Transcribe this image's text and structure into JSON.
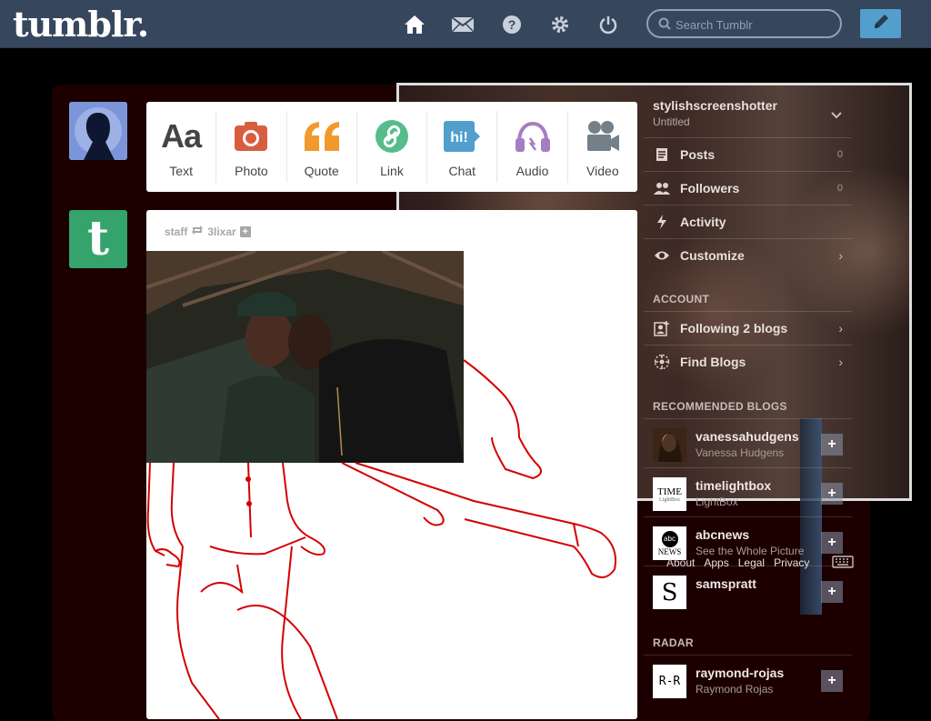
{
  "header": {
    "logo": "tumblr.",
    "search_placeholder": "Search Tumblr",
    "nav": [
      "home-icon",
      "mail-icon",
      "help-icon",
      "gear-icon",
      "power-icon"
    ]
  },
  "post_types": [
    {
      "label": "Text",
      "icon": "text-icon",
      "color": "#444444"
    },
    {
      "label": "Photo",
      "icon": "camera-icon",
      "color": "#d95e40"
    },
    {
      "label": "Quote",
      "icon": "quote-icon",
      "color": "#f2992e"
    },
    {
      "label": "Link",
      "icon": "link-icon",
      "color": "#56bc8a"
    },
    {
      "label": "Chat",
      "icon": "chat-icon",
      "color": "#529ecc"
    },
    {
      "label": "Audio",
      "icon": "headphones-icon",
      "color": "#a77dc2"
    },
    {
      "label": "Video",
      "icon": "video-camera-icon",
      "color": "#748089"
    }
  ],
  "post": {
    "author": "staff",
    "reblogged_from": "3lixar"
  },
  "sidebar": {
    "blog_name": "stylishscreenshotter",
    "blog_title": "Untitled",
    "items": [
      {
        "label": "Posts",
        "count": "0",
        "icon": "posts-icon"
      },
      {
        "label": "Followers",
        "count": "0",
        "icon": "followers-icon"
      },
      {
        "label": "Activity",
        "icon": "activity-icon"
      },
      {
        "label": "Customize",
        "icon": "eye-icon"
      }
    ],
    "account_heading": "ACCOUNT",
    "account_items": [
      {
        "label": "Following 2 blogs",
        "icon": "following-icon"
      },
      {
        "label": "Find Blogs",
        "icon": "compass-icon"
      }
    ],
    "recommended_heading": "RECOMMENDED BLOGS",
    "recommended": [
      {
        "name": "vanessahudgens",
        "sub": "Vanessa Hudgens",
        "thumb": ""
      },
      {
        "name": "timelightbox",
        "sub": "LightBox",
        "thumb": "TIME"
      },
      {
        "name": "abcnews",
        "sub": "See the Whole Picture",
        "thumb": "abc"
      },
      {
        "name": "samspratt",
        "sub": "",
        "thumb": "S"
      }
    ],
    "footer_links": [
      "About",
      "Apps",
      "Legal",
      "Privacy"
    ],
    "radar_heading": "RADAR",
    "radar": [
      {
        "name": "raymond-rojas",
        "sub": "Raymond Rojas",
        "thumb": "R-R"
      }
    ]
  },
  "colors": {
    "header_bg": "#36465d",
    "compose_bg": "#529ecc",
    "staff_green": "#35a36c"
  }
}
